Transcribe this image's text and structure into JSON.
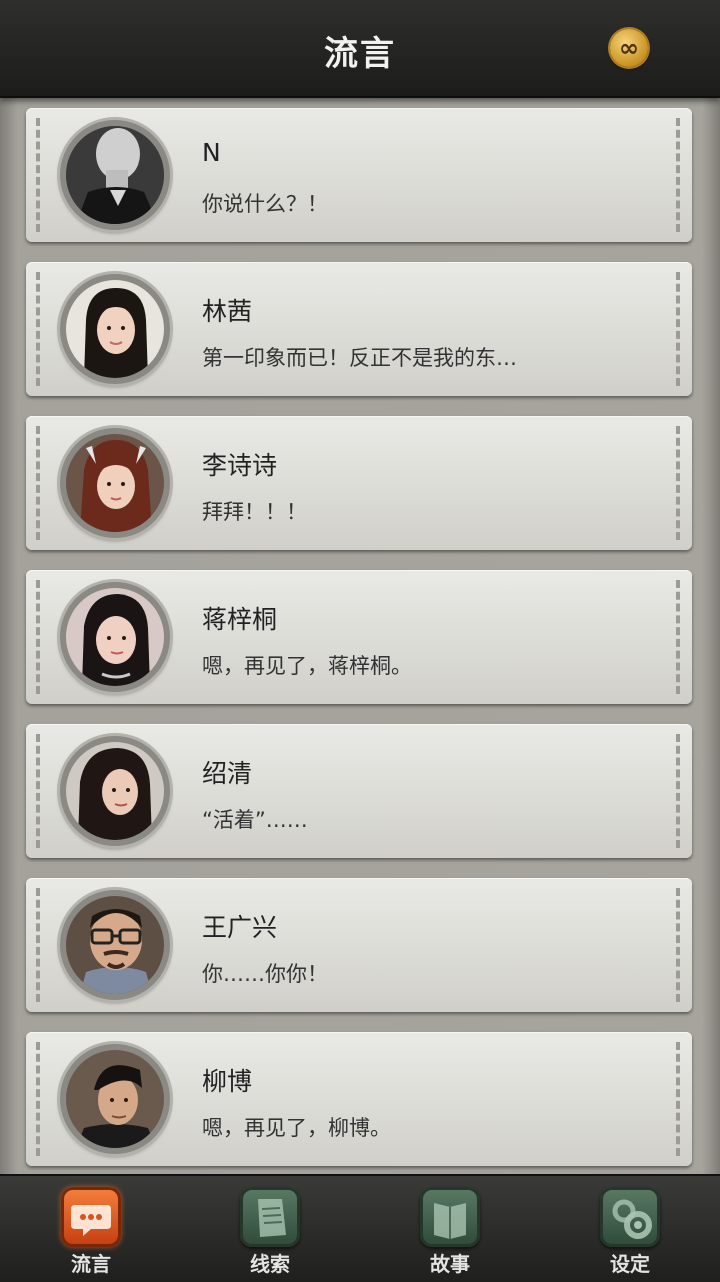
{
  "header": {
    "title": "流言",
    "badge_icon": "infinity-coin-icon",
    "badge_glyph": "∞"
  },
  "contacts": [
    {
      "name": "N",
      "message": "你说什么？！"
    },
    {
      "name": "林茜",
      "message": "第一印象而已！反正不是我的东…"
    },
    {
      "name": "李诗诗",
      "message": "拜拜！！！"
    },
    {
      "name": "蒋梓桐",
      "message": "嗯，再见了，蒋梓桐。"
    },
    {
      "name": "绍清",
      "message": "“活着”……"
    },
    {
      "name": "王广兴",
      "message": "你……你你！"
    },
    {
      "name": "柳博",
      "message": "嗯，再见了，柳博。"
    }
  ],
  "tabs": [
    {
      "label": "流言",
      "icon": "chat-bubble-icon",
      "active": true
    },
    {
      "label": "线索",
      "icon": "notes-icon",
      "active": false
    },
    {
      "label": "故事",
      "icon": "book-icon",
      "active": false
    },
    {
      "label": "设定",
      "icon": "gear-icon",
      "active": false
    }
  ]
}
